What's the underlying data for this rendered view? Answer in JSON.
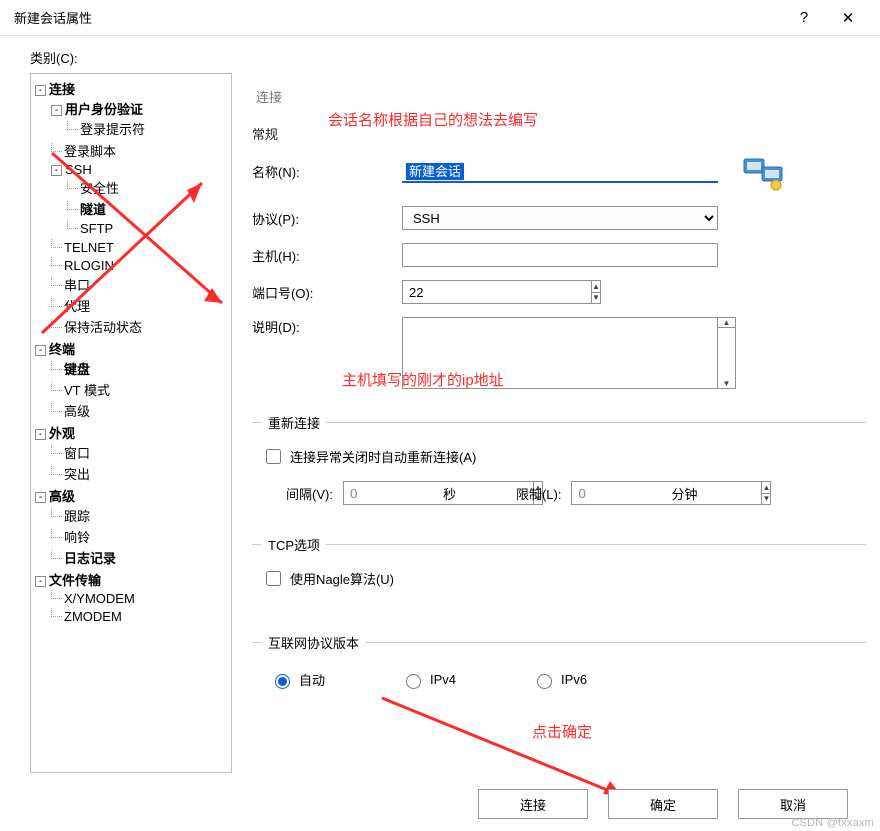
{
  "window": {
    "title": "新建会话属性",
    "help": "?",
    "close": "✕"
  },
  "category_label": "类别(C):",
  "tree": {
    "connection": "连接",
    "user_auth": "用户身份验证",
    "login_prompt": "登录提示符",
    "login_script": "登录脚本",
    "ssh": "SSH",
    "security": "安全性",
    "tunnel": "隧道",
    "sftp": "SFTP",
    "telnet": "TELNET",
    "rlogin": "RLOGIN",
    "serial": "串口",
    "proxy": "代理",
    "keepalive": "保持活动状态",
    "terminal": "终端",
    "keyboard": "键盘",
    "vt_mode": "VT 模式",
    "advanced_term": "高级",
    "appearance": "外观",
    "window": "窗口",
    "highlight": "突出",
    "advanced": "高级",
    "trace": "跟踪",
    "bell": "响铃",
    "logging": "日志记录",
    "file_transfer": "文件传输",
    "xymodem": "X/YMODEM",
    "zmodem": "ZMODEM"
  },
  "crumb": "连接",
  "section_general": "常规",
  "annot": {
    "a1": "会话名称根据自己的想法去编写",
    "a2": "主机填写的刚才的ip地址",
    "a3": "点击确定"
  },
  "form": {
    "name_label": "名称(N):",
    "name_value": "新建会话",
    "protocol_label": "协议(P):",
    "protocol_value": "SSH",
    "host_label": "主机(H):",
    "host_value": "",
    "port_label": "端口号(O):",
    "port_value": "22",
    "desc_label": "说明(D):",
    "desc_value": ""
  },
  "reconnect": {
    "legend": "重新连接",
    "chk_label": "连接异常关闭时自动重新连接(A)",
    "interval_label": "间隔(V):",
    "interval_value": "0",
    "seconds": "秒",
    "limit_label": "限制(L):",
    "limit_value": "0",
    "minutes": "分钟"
  },
  "tcp": {
    "legend": "TCP选项",
    "nagle_label": "使用Nagle算法(U)"
  },
  "ipver": {
    "legend": "互联网协议版本",
    "auto": "自动",
    "ipv4": "IPv4",
    "ipv6": "IPv6"
  },
  "buttons": {
    "connect": "连接",
    "ok": "确定",
    "cancel": "取消"
  },
  "watermark": "CSDN @txxaxm"
}
